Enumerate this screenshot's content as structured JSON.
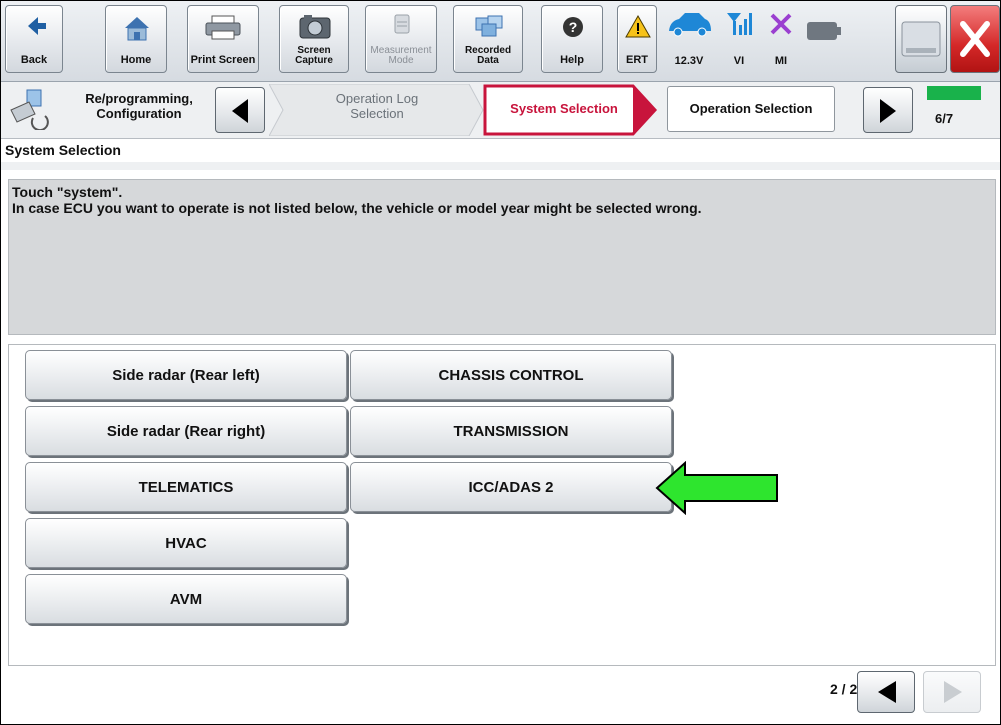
{
  "toolbar": {
    "back_label": "Back",
    "home_label": "Home",
    "print_screen_label": "Print Screen",
    "screen_capture_label": "Screen\nCapture",
    "measurement_mode_label": "Measurement\nMode",
    "recorded_data_label": "Recorded\nData",
    "help_label": "Help",
    "ert_label": "ERT",
    "voltage_label": "12.3V",
    "vi_label": "VI",
    "mi_label": "MI"
  },
  "nav": {
    "mode_label": "Re/programming,\nConfiguration",
    "steps": [
      "Operation Log\nSelection",
      "System Selection",
      "Operation Selection"
    ],
    "step_counter": "6/7"
  },
  "section_title": "System Selection",
  "message": {
    "line1": "Touch \"system\".",
    "line2": "In case ECU you want to operate is not listed below, the vehicle or model year might be selected wrong."
  },
  "systems": {
    "col1": [
      "Side radar (Rear left)",
      "Side radar (Rear right)",
      "TELEMATICS",
      "HVAC",
      "AVM"
    ],
    "col2": [
      "CHASSIS CONTROL",
      "TRANSMISSION",
      "ICC/ADAS 2"
    ]
  },
  "pager": {
    "text": "2 / 2"
  },
  "colors": {
    "accent_red": "#c8143c",
    "progress_green": "#19b24b",
    "callout_arrow": "#2ee52e"
  }
}
